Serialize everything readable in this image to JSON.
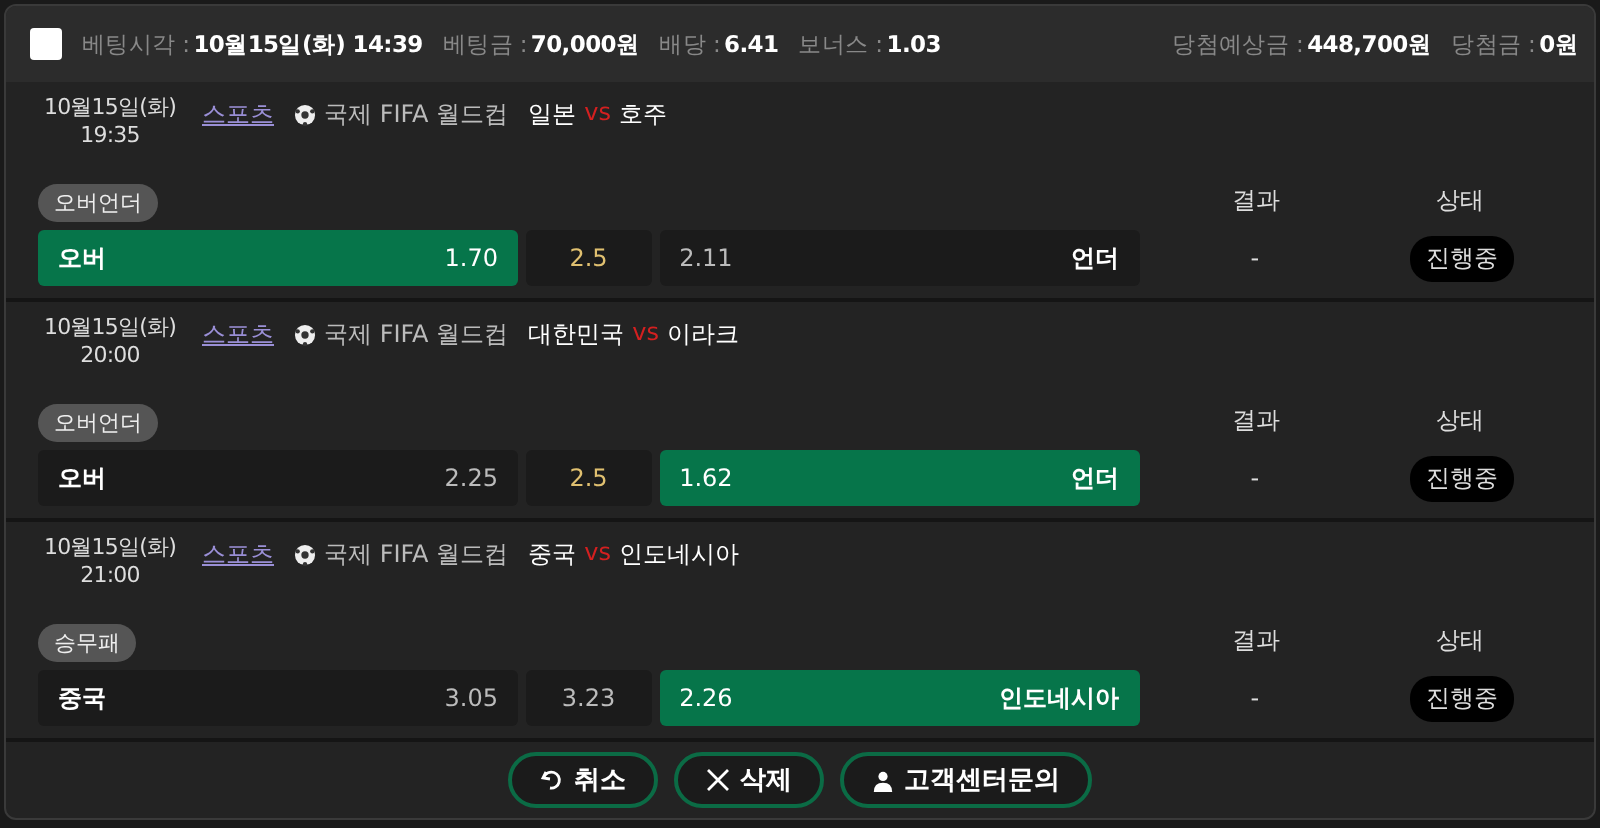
{
  "header": {
    "checked": false,
    "fields": [
      {
        "label": "베팅시각 :",
        "value": "10월15일(화) 14:39"
      },
      {
        "label": "베팅금 :",
        "value": "70,000원"
      },
      {
        "label": "배당 :",
        "value": "6.41"
      },
      {
        "label": "보너스 :",
        "value": "1.03"
      }
    ],
    "right_fields": [
      {
        "label": "당첨예상금 :",
        "value": "448,700원"
      },
      {
        "label": "당첨금 :",
        "value": "0원"
      }
    ]
  },
  "games": [
    {
      "date": "10월15일(화)",
      "time": "19:35",
      "category": "스포츠",
      "league": "국제 FIFA 월드컵",
      "home_team": "일본",
      "vs": "vs",
      "away_team": "호주",
      "market": "오버언더",
      "result_label": "결과",
      "status_label": "상태",
      "home": {
        "name": "오버",
        "odds": "1.70",
        "selected": true
      },
      "line": "2.5",
      "kind": "over_under",
      "away": {
        "name": "언더",
        "odds": "2.11",
        "selected": false
      },
      "result": "-",
      "status": "진행중"
    },
    {
      "date": "10월15일(화)",
      "time": "20:00",
      "category": "스포츠",
      "league": "국제 FIFA 월드컵",
      "home_team": "대한민국",
      "vs": "vs",
      "away_team": "이라크",
      "market": "오버언더",
      "result_label": "결과",
      "status_label": "상태",
      "home": {
        "name": "오버",
        "odds": "2.25",
        "selected": false
      },
      "line": "2.5",
      "kind": "over_under",
      "away": {
        "name": "언더",
        "odds": "1.62",
        "selected": true
      },
      "result": "-",
      "status": "진행중"
    },
    {
      "date": "10월15일(화)",
      "time": "21:00",
      "category": "스포츠",
      "league": "국제 FIFA 월드컵",
      "home_team": "중국",
      "vs": "vs",
      "away_team": "인도네시아",
      "market": "승무패",
      "result_label": "결과",
      "status_label": "상태",
      "home": {
        "name": "중국",
        "odds": "3.05",
        "selected": false
      },
      "line": "3.23",
      "kind": "win_draw_lose",
      "away": {
        "name": "인도네시아",
        "odds": "2.26",
        "selected": true
      },
      "result": "-",
      "status": "진행중"
    }
  ],
  "buttons": [
    {
      "kind": "undo",
      "label": "취소"
    },
    {
      "kind": "close",
      "label": "삭제"
    },
    {
      "kind": "person",
      "label": "고객센터문의"
    }
  ]
}
